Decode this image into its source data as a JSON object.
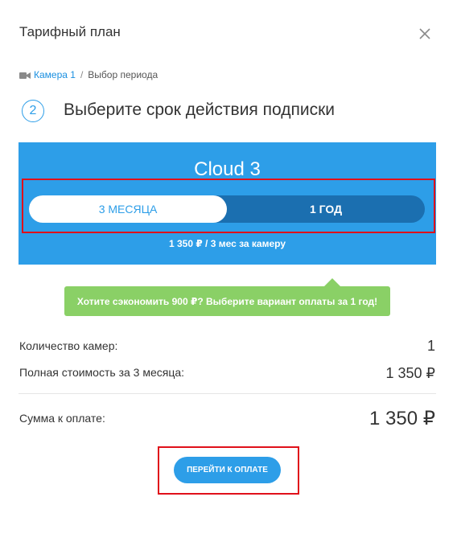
{
  "header": {
    "title": "Тарифный план",
    "close_icon": "close-icon"
  },
  "breadcrumb": {
    "icon": "camera-icon",
    "link": "Камера 1",
    "separator": "/",
    "current": "Выбор периода"
  },
  "step": {
    "number": "2",
    "title": "Выберите срок действия подписки"
  },
  "plan": {
    "name": "Cloud 3",
    "periods": [
      {
        "label": "3 МЕСЯЦА",
        "selected": true
      },
      {
        "label": "1 ГОД",
        "selected": false
      }
    ],
    "price_per_camera": "1 350 ₽ / 3 мес за камеру"
  },
  "tip": {
    "text": "Хотите сэкономить 900 ₽? Выберите вариант оплаты за 1 год!"
  },
  "summary": {
    "camera_count_label": "Количество камер:",
    "camera_count_value": "1",
    "full_cost_label": "Полная стоимость за 3 месяца:",
    "full_cost_value": "1 350 ₽",
    "total_label": "Сумма к оплате:",
    "total_value": "1 350 ₽"
  },
  "actions": {
    "pay_label": "ПЕРЕЙТИ К ОПЛАТЕ"
  },
  "colors": {
    "accent_blue": "#2d9ee8",
    "toggle_dark_blue": "#1b6fb0",
    "tip_green": "#8ad066",
    "highlight_red": "#e0101a"
  }
}
